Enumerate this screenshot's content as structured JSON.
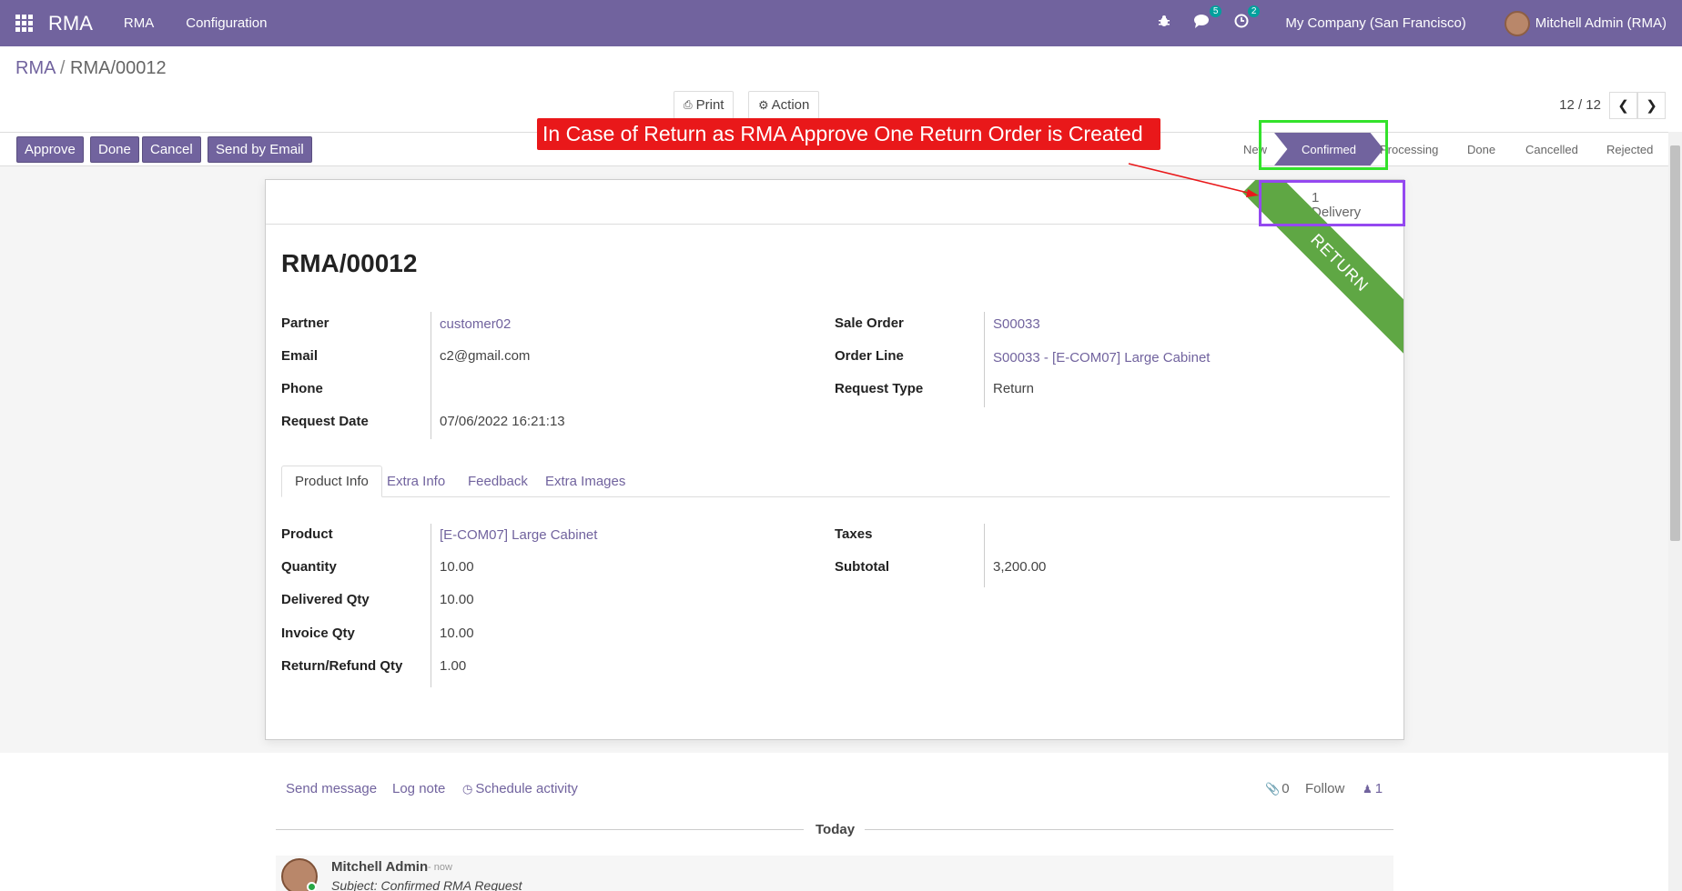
{
  "navbar": {
    "brand": "RMA",
    "menus": [
      "RMA",
      "Configuration"
    ],
    "messages_count": "5",
    "activities_count": "2",
    "company": "My Company (San Francisco)",
    "user": "Mitchell Admin (RMA)"
  },
  "breadcrumb": {
    "root": "RMA",
    "separator": "/",
    "current": "RMA/00012"
  },
  "toolbar": {
    "print": "Print",
    "action": "Action",
    "pager": "12 / 12"
  },
  "statusbar": {
    "buttons": [
      "Approve",
      "Done",
      "Cancel",
      "Send by Email"
    ],
    "stages": [
      "New",
      "Confirmed",
      "Processing",
      "Done",
      "Cancelled",
      "Rejected"
    ],
    "active_stage": "Confirmed"
  },
  "annotation": {
    "note": "In Case of Return as RMA Approve One Return Order is Created",
    "highlight_green": "#33e22b",
    "highlight_purple": "#9448f0",
    "note_color": "#e9181a"
  },
  "smart_button": {
    "count": "1",
    "label": "Delivery",
    "icon": "truck-icon"
  },
  "ribbon": "RETURN",
  "form": {
    "title": "RMA/00012",
    "left": [
      {
        "label": "Partner",
        "value": "customer02",
        "link": true
      },
      {
        "label": "Email",
        "value": "c2@gmail.com",
        "link": false
      },
      {
        "label": "Phone",
        "value": "",
        "link": false
      },
      {
        "label": "Request Date",
        "value": "07/06/2022 16:21:13",
        "link": false
      }
    ],
    "right": [
      {
        "label": "Sale Order",
        "value": "S00033",
        "link": true
      },
      {
        "label": "Order Line",
        "value": "S00033 - [E-COM07] Large Cabinet",
        "link": true
      },
      {
        "label": "Request Type",
        "value": "Return",
        "link": false
      }
    ],
    "tabs": [
      "Product Info",
      "Extra Info",
      "Feedback",
      "Extra Images"
    ],
    "product_left": [
      {
        "label": "Product",
        "value": "[E-COM07] Large Cabinet",
        "link": true
      },
      {
        "label": "Quantity",
        "value": "10.00"
      },
      {
        "label": "Delivered Qty",
        "value": "10.00"
      },
      {
        "label": "Invoice Qty",
        "value": "10.00"
      },
      {
        "label": "Return/Refund Qty",
        "value": "1.00"
      }
    ],
    "product_right": [
      {
        "label": "Taxes",
        "value": ""
      },
      {
        "label": "Subtotal",
        "value": "3,200.00"
      }
    ]
  },
  "chatter": {
    "send_message": "Send message",
    "log_note": "Log note",
    "schedule_activity": "Schedule activity",
    "attachments": "0",
    "follow": "Follow",
    "followers": "1",
    "date_separator": "Today",
    "message": {
      "author": "Mitchell Admin",
      "time": "- now",
      "subject": "Subject: Confirmed RMA Request"
    }
  },
  "colors": {
    "brand": "#71639e",
    "ribbon": "#5fa744"
  }
}
